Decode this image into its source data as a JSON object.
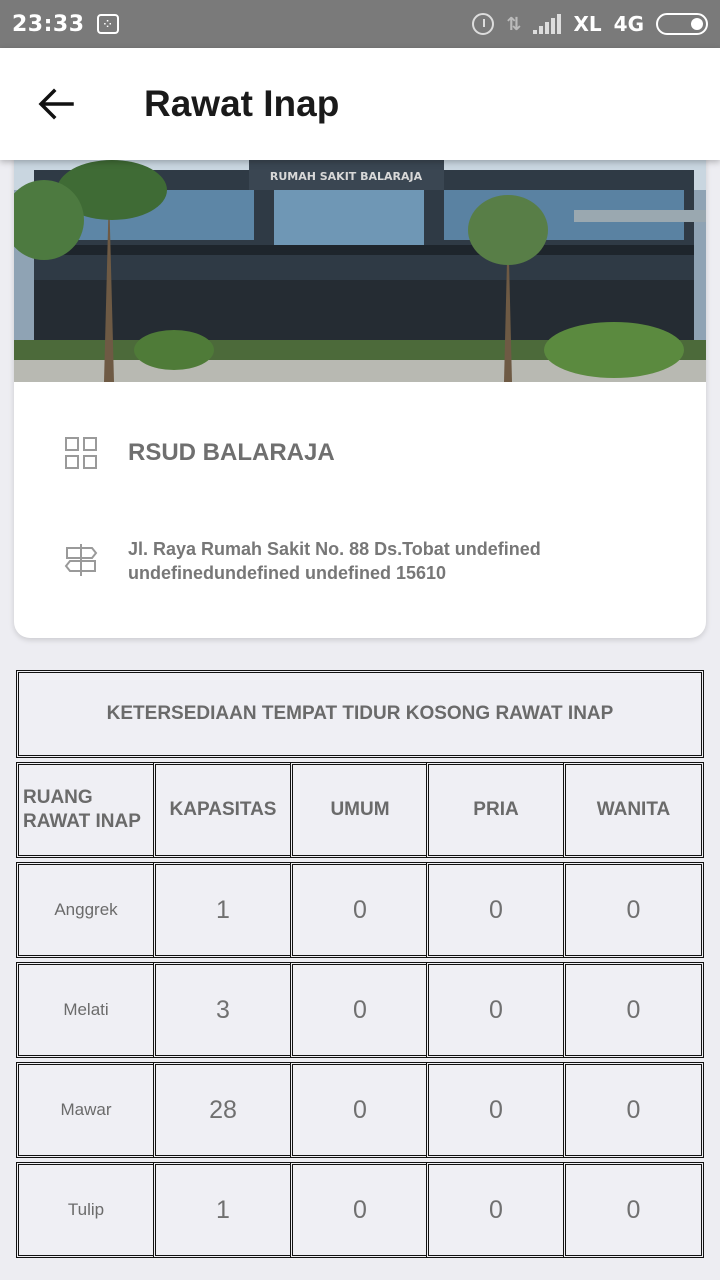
{
  "status_bar": {
    "time": "23:33",
    "carrier": "XL",
    "network": "4G"
  },
  "app_bar": {
    "title": "Rawat Inap"
  },
  "hospital": {
    "photo_sign": "RUMAH SAKIT BALARAJA",
    "name": "RSUD BALARAJA",
    "address_line1": "Jl. Raya Rumah Sakit No. 88  Ds.Tobat undefined",
    "address_line2": "undefinedundefined undefined 15610"
  },
  "table": {
    "title": "KETERSEDIAAN TEMPAT TIDUR KOSONG RAWAT INAP",
    "headers": [
      "RUANG RAWAT INAP",
      "KAPASITAS",
      "UMUM",
      "PRIA",
      "WANITA"
    ],
    "rows": [
      {
        "room": "Anggrek",
        "kapasitas": "1",
        "umum": "0",
        "pria": "0",
        "wanita": "0"
      },
      {
        "room": "Melati",
        "kapasitas": "3",
        "umum": "0",
        "pria": "0",
        "wanita": "0"
      },
      {
        "room": "Mawar",
        "kapasitas": "28",
        "umum": "0",
        "pria": "0",
        "wanita": "0"
      },
      {
        "room": "Tulip",
        "kapasitas": "1",
        "umum": "0",
        "pria": "0",
        "wanita": "0"
      }
    ]
  }
}
